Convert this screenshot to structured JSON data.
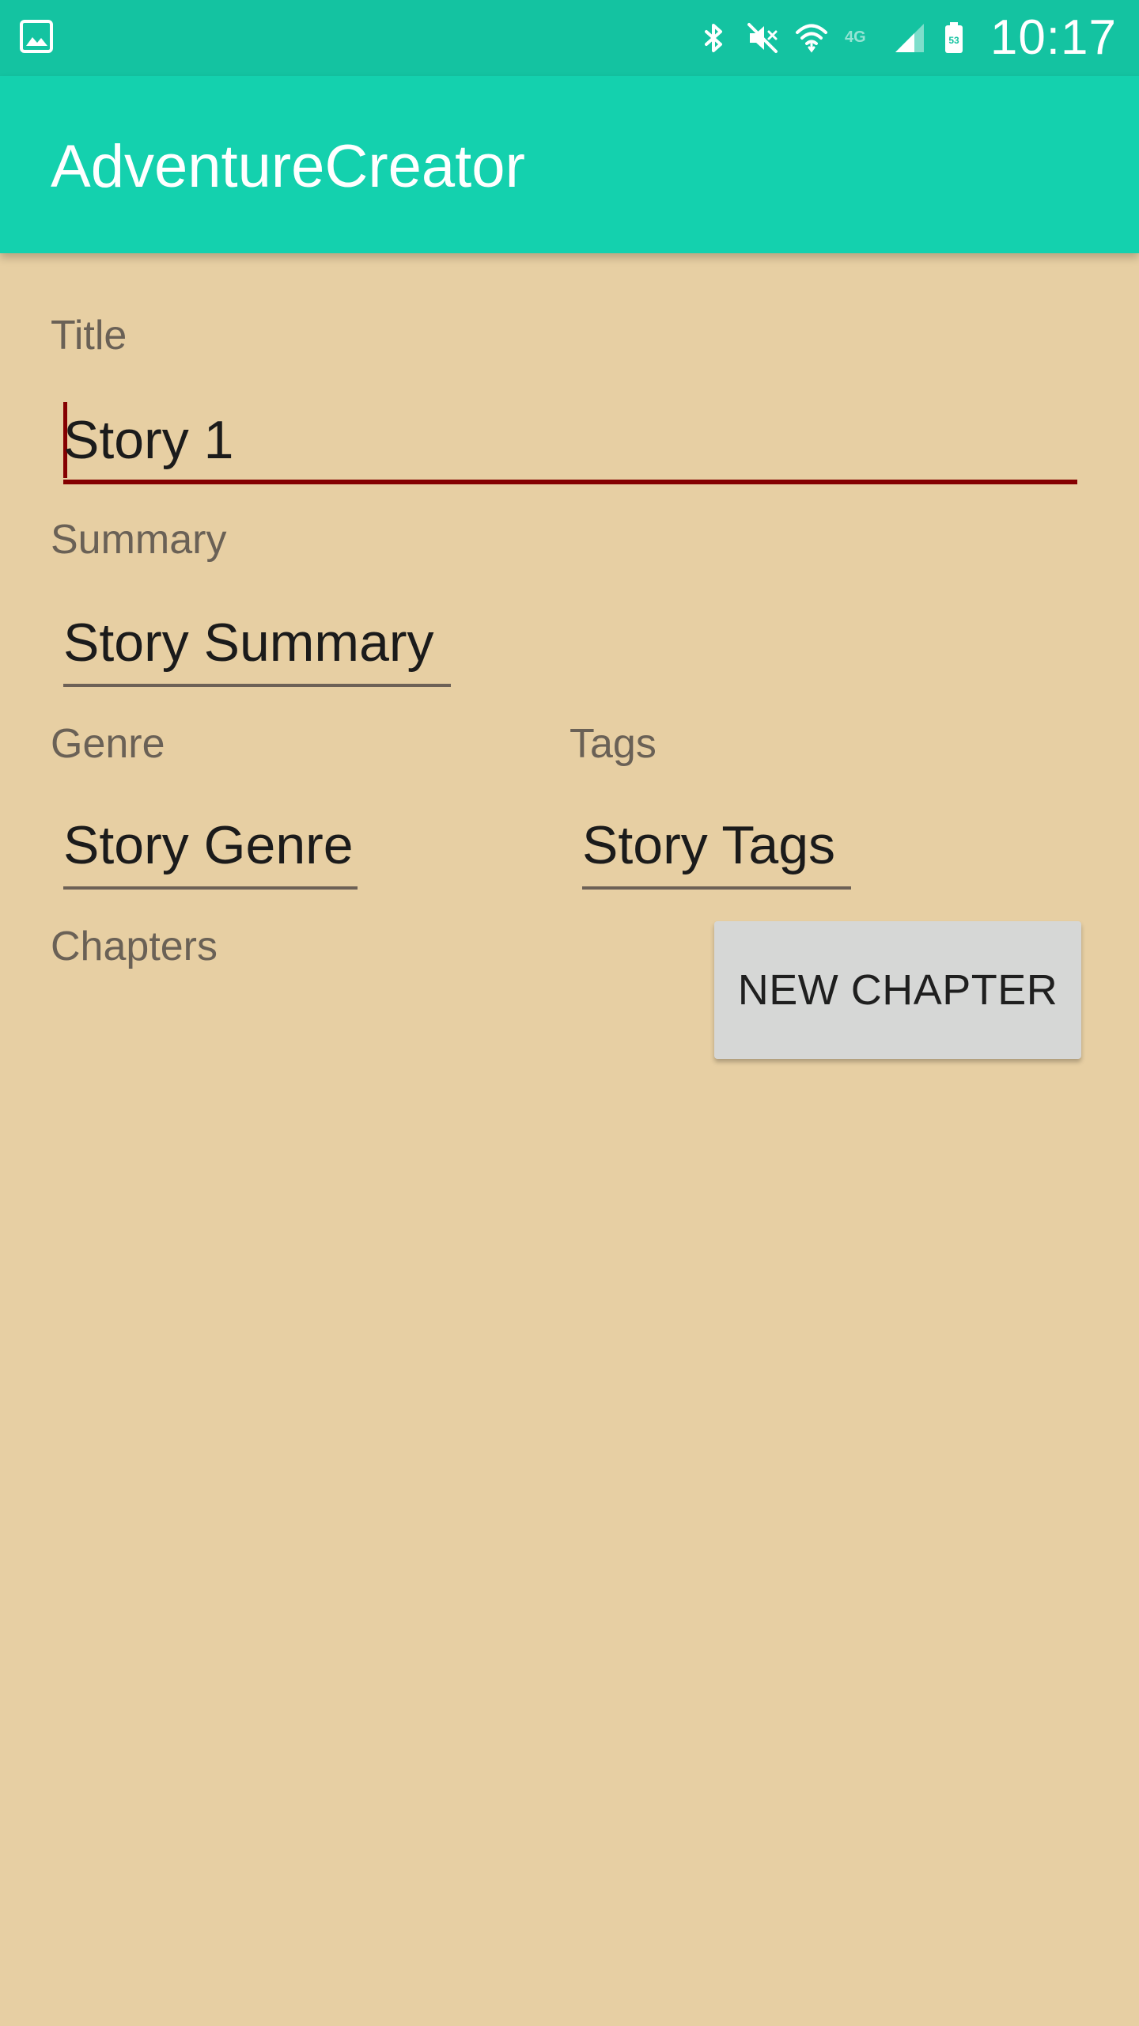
{
  "status_bar": {
    "time": "10:17",
    "battery_level": "53",
    "network_label": "4G",
    "icons": [
      "gallery-icon",
      "bluetooth-icon",
      "mute-icon",
      "wifi-icon",
      "network-4g-icon",
      "signal-icon",
      "battery-icon"
    ]
  },
  "app_bar": {
    "title": "AdventureCreator"
  },
  "form": {
    "title_label": "Title",
    "title_value": "Story 1",
    "summary_label": "Summary",
    "summary_value": "Story Summary",
    "genre_label": "Genre",
    "genre_value": "Story Genre",
    "tags_label": "Tags",
    "tags_value": "Story Tags",
    "chapters_label": "Chapters",
    "new_chapter_button": "NEW CHAPTER"
  },
  "colors": {
    "status_bar": "#14c3a1",
    "app_bar": "#14d1ae",
    "background": "#e7cfa3",
    "focused_underline": "#850000",
    "button": "#d6d7d6"
  }
}
